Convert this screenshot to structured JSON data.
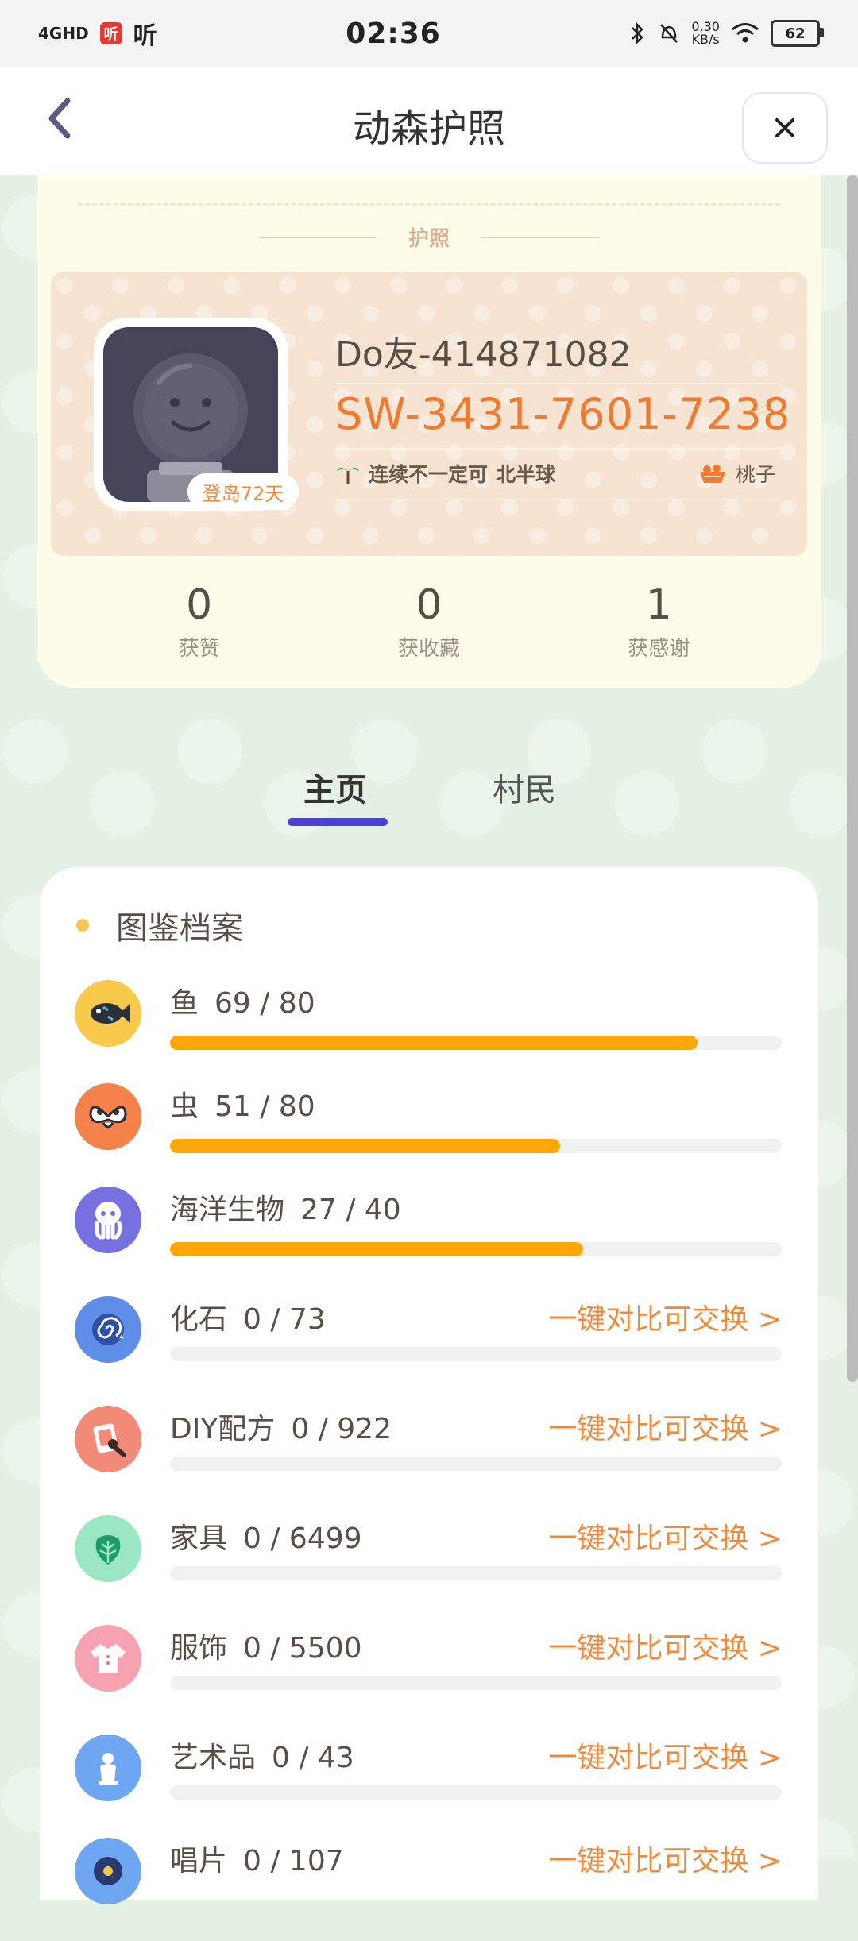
{
  "status_bar": {
    "network": "4GHD",
    "app_badge": "听",
    "app_label": "听",
    "time": "02:36",
    "net_speed_value": "0.30",
    "net_speed_unit": "KB/s",
    "battery": "62"
  },
  "nav": {
    "title": "动森护照"
  },
  "passport": {
    "label": "护照",
    "user_name": "Do友-414871082",
    "friend_code": "SW-3431-7601-7238",
    "island_badge": "登岛72天",
    "island_name": "连续不一定可",
    "hemisphere": "北半球",
    "fruit": "桃子",
    "stats": [
      {
        "value": "0",
        "label": "获赞"
      },
      {
        "value": "0",
        "label": "获收藏"
      },
      {
        "value": "1",
        "label": "获感谢"
      }
    ]
  },
  "tabs": [
    {
      "label": "主页",
      "active": true
    },
    {
      "label": "村民",
      "active": false
    }
  ],
  "catalog": {
    "title": "图鉴档案",
    "accent_color": "#ffa60a",
    "action_color": "#f0893c",
    "items": [
      {
        "name": "鱼",
        "count": "69 / 80",
        "collected": 69,
        "total": 80,
        "icon": "fish-icon",
        "icon_bg": "#f9c94c",
        "action": ""
      },
      {
        "name": "虫",
        "count": "51 / 80",
        "collected": 51,
        "total": 80,
        "icon": "bug-icon",
        "icon_bg": "#f4824a",
        "action": ""
      },
      {
        "name": "海洋生物",
        "count": "27 / 40",
        "collected": 27,
        "total": 40,
        "icon": "octopus-icon",
        "icon_bg": "#7670e0",
        "action": ""
      },
      {
        "name": "化石",
        "count": "0 / 73",
        "collected": 0,
        "total": 73,
        "icon": "fossil-icon",
        "icon_bg": "#5f8ee8",
        "action": "一键对比可交换 >"
      },
      {
        "name": "DIY配方",
        "count": "0 / 922",
        "collected": 0,
        "total": 922,
        "icon": "diy-recipe-icon",
        "icon_bg": "#f28a78",
        "action": "一键对比可交换 >"
      },
      {
        "name": "家具",
        "count": "0 / 6499",
        "collected": 0,
        "total": 6499,
        "icon": "leaf-icon",
        "icon_bg": "#9be7c4",
        "action": "一键对比可交换 >"
      },
      {
        "name": "服饰",
        "count": "0 / 5500",
        "collected": 0,
        "total": 5500,
        "icon": "shirt-icon",
        "icon_bg": "#f7a2b0",
        "action": "一键对比可交换 >"
      },
      {
        "name": "艺术品",
        "count": "0 / 43",
        "collected": 0,
        "total": 43,
        "icon": "statue-icon",
        "icon_bg": "#6ea6f2",
        "action": "一键对比可交换 >"
      },
      {
        "name": "唱片",
        "count": "0 / 107",
        "collected": 0,
        "total": 107,
        "icon": "record-icon",
        "icon_bg": "#6ea6f2",
        "action": "一键对比可交换 >"
      }
    ]
  }
}
